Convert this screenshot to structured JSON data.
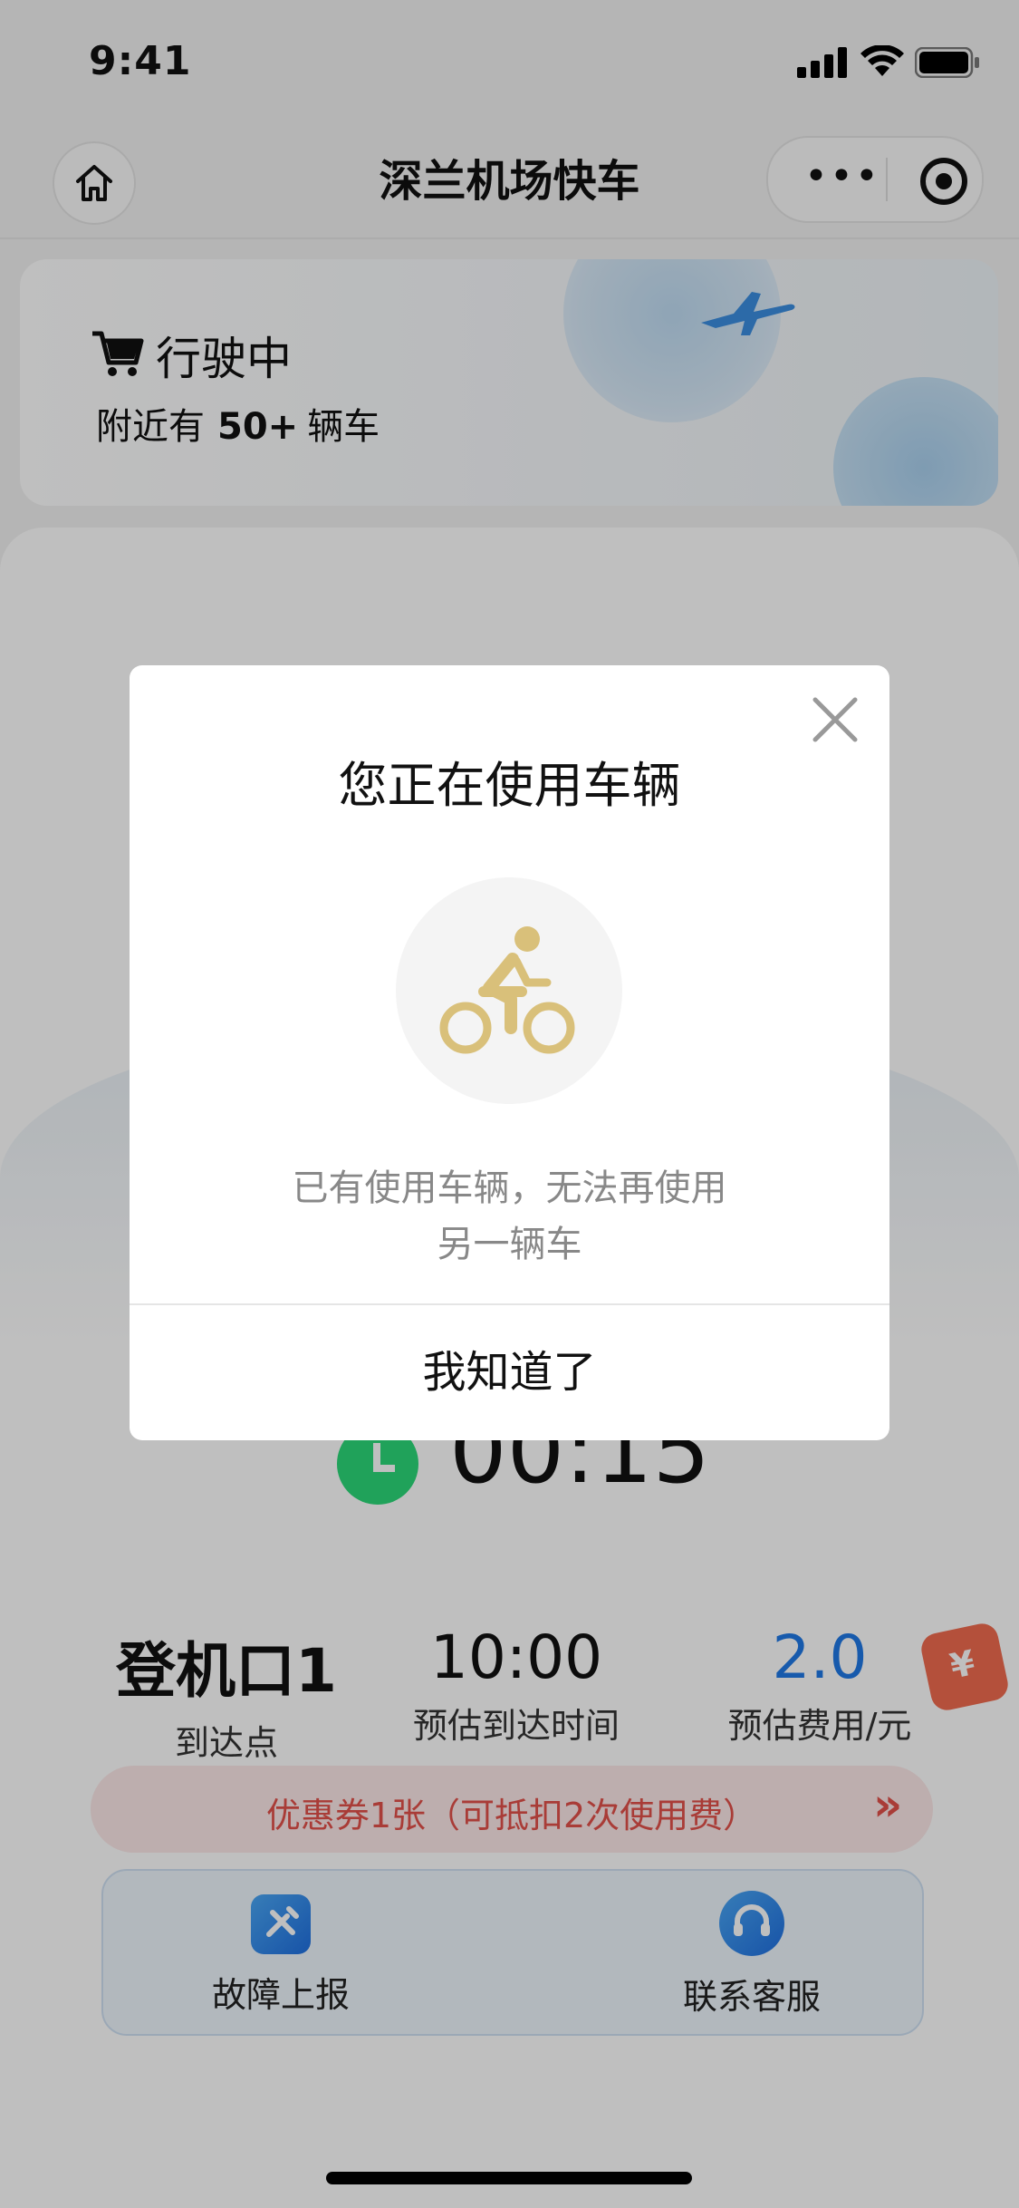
{
  "status_bar": {
    "time": "9:41"
  },
  "nav": {
    "title": "深兰机场快车"
  },
  "status_card": {
    "title": "行驶中",
    "nearby_prefix": "附近有",
    "nearby_count": "50+",
    "nearby_suffix": "辆车"
  },
  "timer": {
    "value": "00:15"
  },
  "stats": [
    {
      "value": "登机口1",
      "label": "到达点"
    },
    {
      "value": "10:00",
      "label": "预估到达时间"
    },
    {
      "value": "2.0",
      "label": "预估费用/元"
    }
  ],
  "coupon": {
    "text": "优惠券1张（可抵扣2次使用费）",
    "arrow": "»",
    "tag_symbol": "¥"
  },
  "tools": [
    {
      "label": "故障上报",
      "icon": "wrench-icon"
    },
    {
      "label": "联系客服",
      "icon": "headset-icon"
    }
  ],
  "dialog": {
    "title": "您正在使用车辆",
    "message_line1": "已有使用车辆，无法再使用",
    "message_line2": "另一辆车",
    "button": "我知道了",
    "icon": "bike-icon"
  },
  "colors": {
    "accent_blue": "#1f78e6",
    "coupon_red": "#e2504a",
    "timer_green": "#2bd878",
    "bike_gold": "#d9c07a"
  }
}
